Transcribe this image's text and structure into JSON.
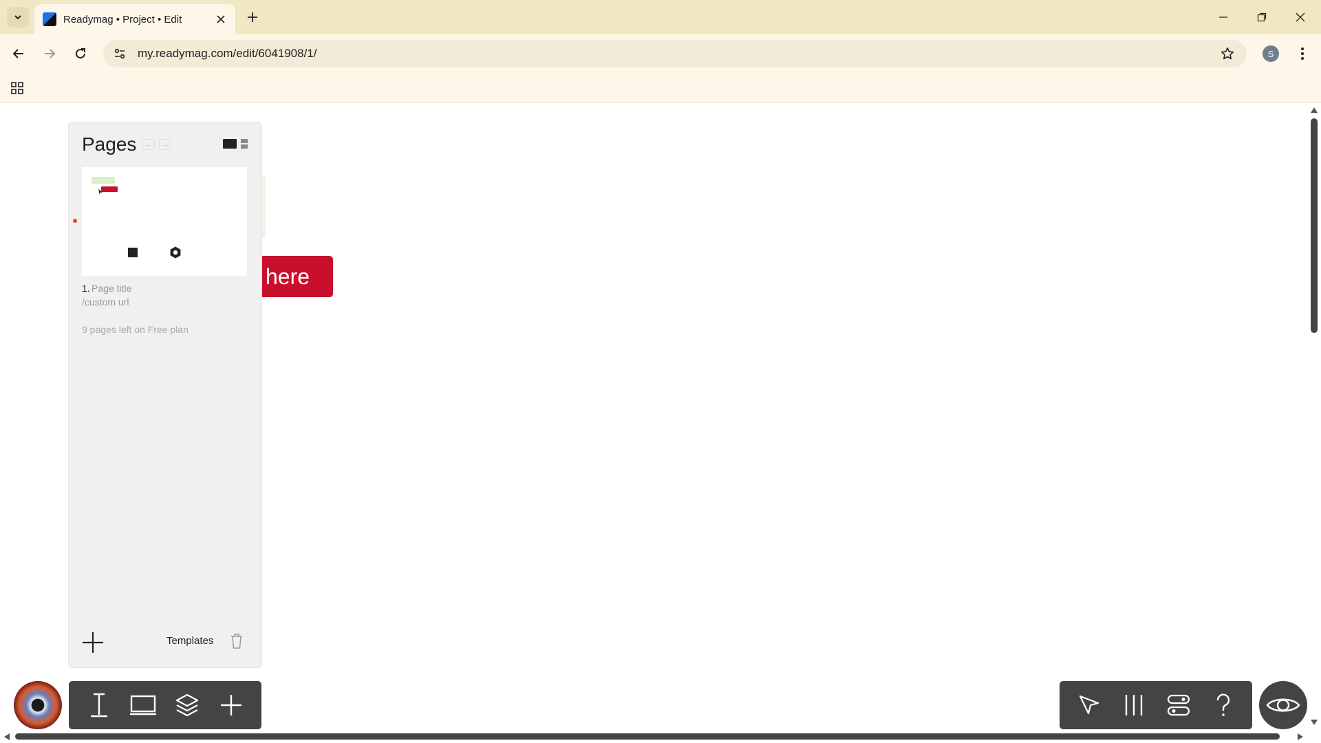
{
  "browser": {
    "tab_title": "Readymag • Project • Edit",
    "url": "my.readymag.com/edit/6041908/1/",
    "profile_initial": "S"
  },
  "icons": {
    "tab_search": "chevron-down-icon",
    "tab_close": "close-icon",
    "new_tab": "plus-icon",
    "minimize": "minimize-icon",
    "restore": "restore-icon",
    "close_window": "close-icon",
    "back": "arrow-left-icon",
    "forward": "arrow-right-icon",
    "reload": "reload-icon",
    "site_info": "tune-icon",
    "bookmark": "star-icon",
    "menu": "more-vertical-icon",
    "apps": "apps-grid-icon"
  },
  "pages_panel": {
    "title": "Pages",
    "prev_label": "←",
    "next_label": "→",
    "page": {
      "number": "1.",
      "title_placeholder": "Page title",
      "url_placeholder": "/custom url"
    },
    "pages_left": "9 pages left on Free plan",
    "templates_label": "Templates"
  },
  "canvas": {
    "button_text": "here",
    "button_color": "#c8102e"
  },
  "colors": {
    "tabstrip": "#efe8c2",
    "toolbar": "#fdf6e9",
    "panel": "#f0f0f0",
    "tools": "#444444"
  }
}
